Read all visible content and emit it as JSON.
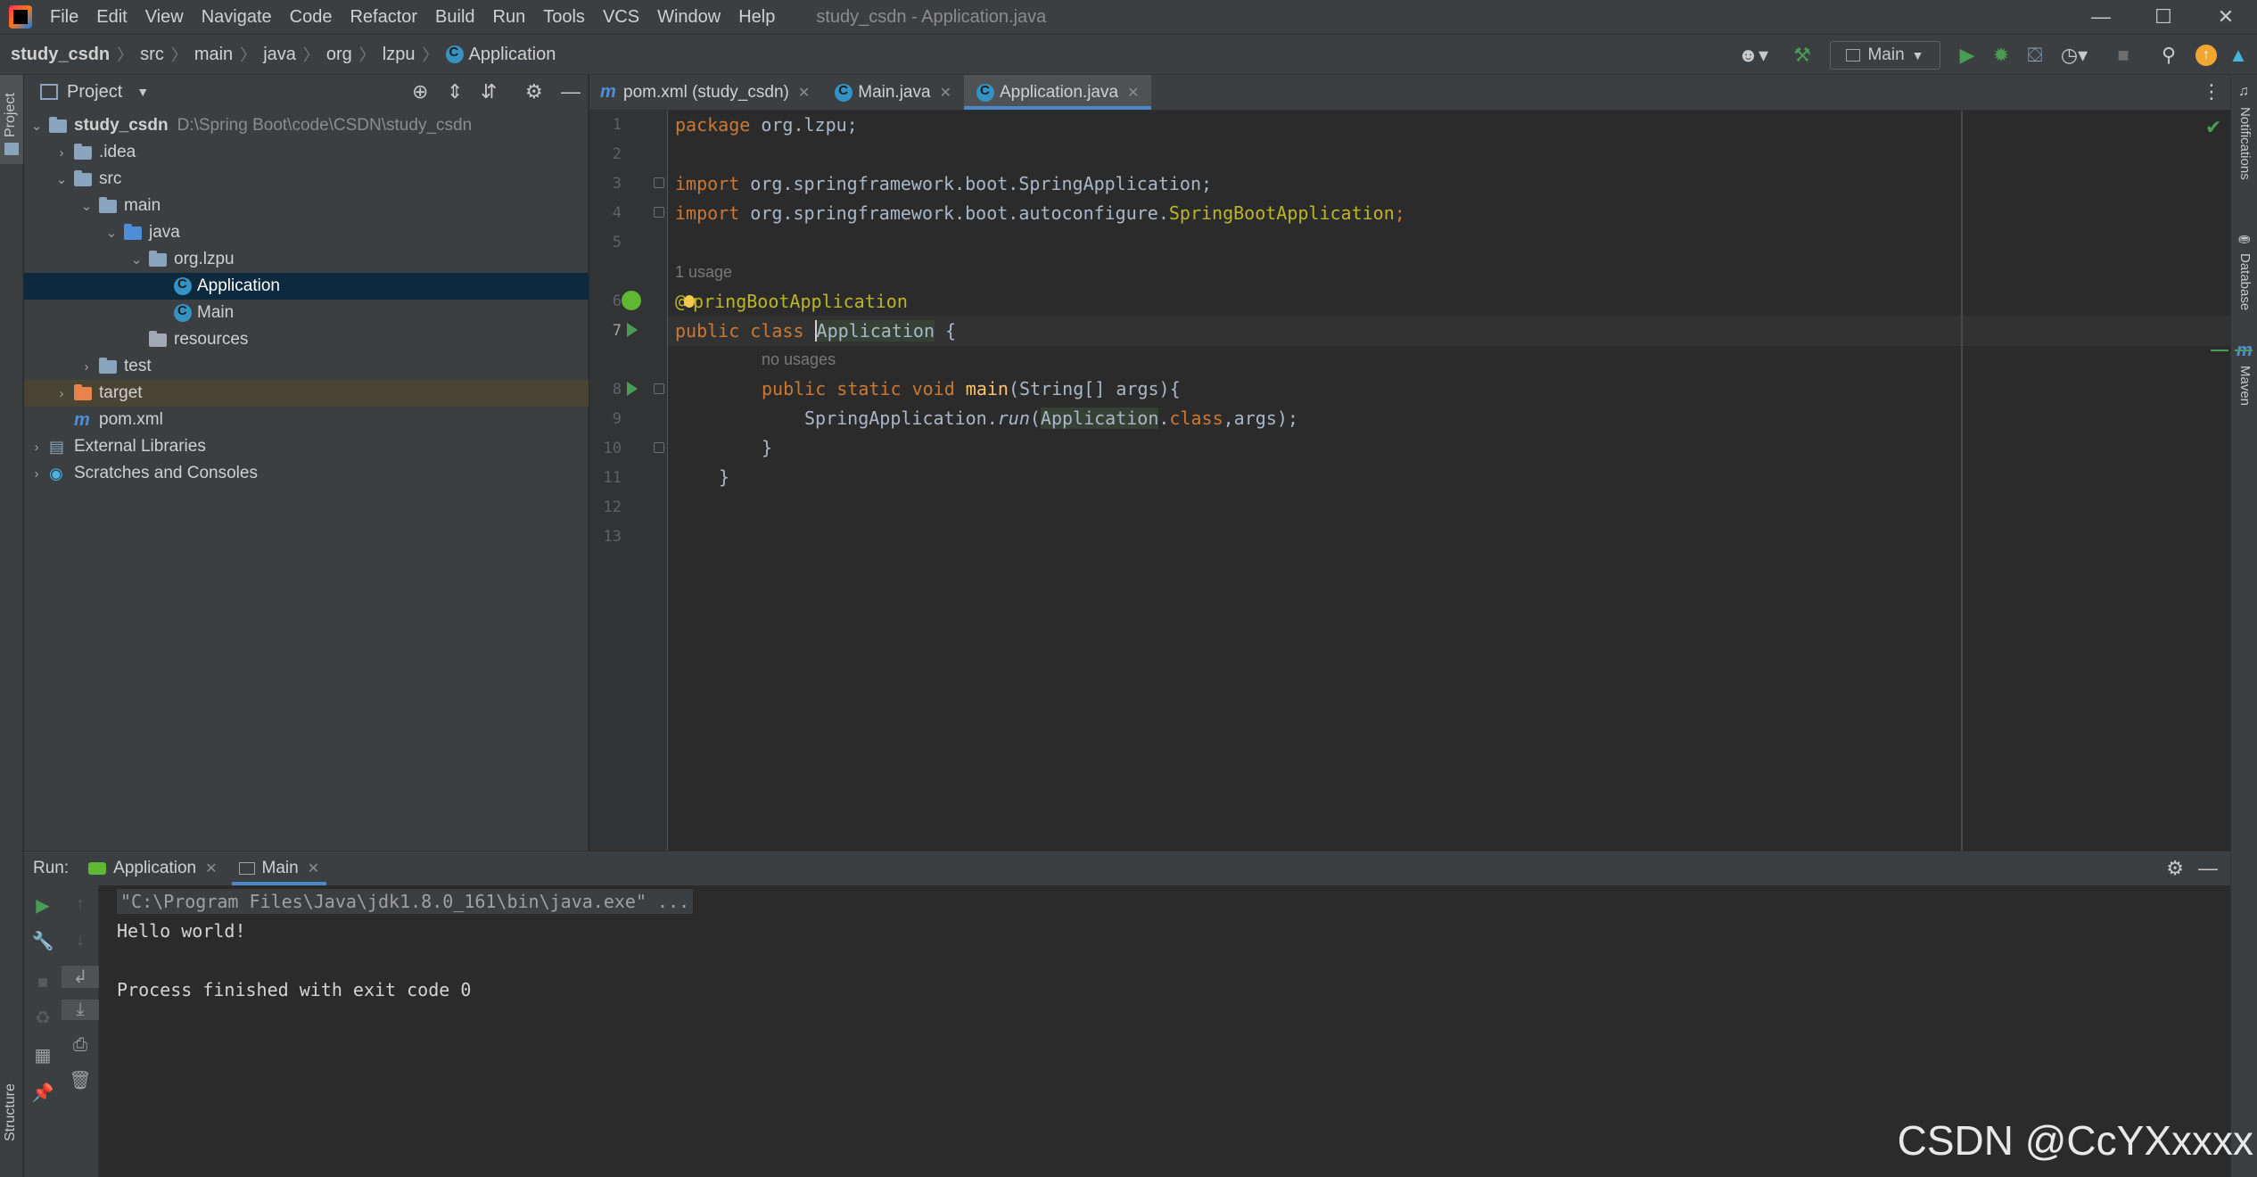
{
  "menu": {
    "items": [
      "File",
      "Edit",
      "View",
      "Navigate",
      "Code",
      "Refactor",
      "Build",
      "Run",
      "Tools",
      "VCS",
      "Window",
      "Help"
    ],
    "window_title": "study_csdn - Application.java"
  },
  "breadcrumb": {
    "items": [
      "study_csdn",
      "src",
      "main",
      "java",
      "org",
      "lzpu",
      "Application"
    ]
  },
  "toolbar": {
    "run_config": "Main"
  },
  "left_strip": {
    "project_label": "Project",
    "structure_label": "Structure"
  },
  "project": {
    "header": "Project",
    "root_path": "D:\\Spring Boot\\code\\CSDN\\study_csdn",
    "tree": [
      "study_csdn",
      ".idea",
      "src",
      "main",
      "java",
      "org.lzpu",
      "Application",
      "Main",
      "resources",
      "test",
      "target",
      "pom.xml",
      "External Libraries",
      "Scratches and Consoles"
    ]
  },
  "editor": {
    "tabs": [
      "pom.xml (study_csdn)",
      "Main.java",
      "Application.java"
    ],
    "line_numbers": [
      "1",
      "2",
      "3",
      "4",
      "5",
      "6",
      "7",
      "8",
      "9",
      "10",
      "11",
      "12",
      "13"
    ],
    "code": {
      "l1_kw": "package",
      "l1_rest": " org.lzpu;",
      "l3_kw": "import",
      "l3_rest": " org.springframework.boot.SpringApplication;",
      "l4_kw": "import",
      "l4_rest": " org.springframework.boot.autoconfigure.",
      "l4_cls": "SpringBootApplication",
      "l4_end": ";",
      "usage_hint": "1 usage",
      "l6_at": "@",
      "l6_ann": "pringBootApplication",
      "l7_kw": "public class",
      "l7_name": "Application",
      "l7_end": " {",
      "no_usages_hint": "no usages",
      "l8_kw": "public static void",
      "l8_fn": "main",
      "l8_rest": "(String[] args){",
      "l9_a": "SpringApplication.",
      "l9_run": "run",
      "l9_b": "(",
      "l9_cls": "Application",
      "l9_c": ".",
      "l9_kw": "class",
      "l9_d": ",args);",
      "l10": "}",
      "l11": "}"
    }
  },
  "right_strip": {
    "items": [
      "Notifications",
      "Database",
      "Maven"
    ]
  },
  "run_panel": {
    "label": "Run:",
    "tabs": [
      "Application",
      "Main"
    ],
    "console": [
      "\"C:\\Program Files\\Java\\jdk1.8.0_161\\bin\\java.exe\" ...",
      "Hello world!",
      "",
      "Process finished with exit code 0"
    ]
  },
  "watermark": "CSDN @CcYXxxxx",
  "colors": {
    "keyword": "#cc7832",
    "annotation": "#bbb529",
    "function": "#ffc66d",
    "accent": "#4a88c7",
    "run_green": "#499c54"
  }
}
